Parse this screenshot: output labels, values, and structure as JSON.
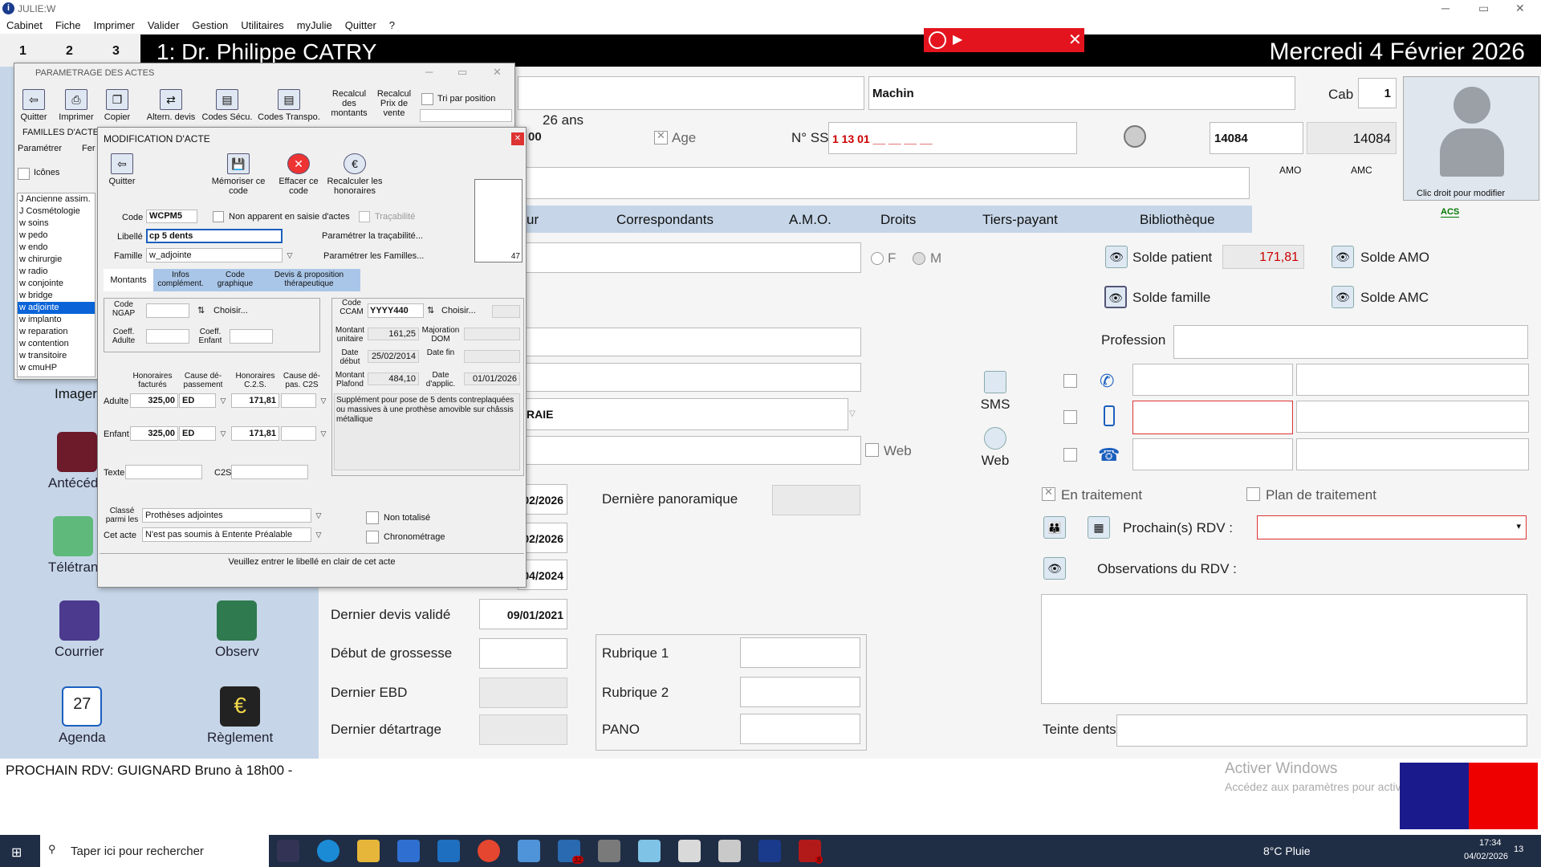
{
  "window": {
    "title": "JULIE:W",
    "controls": {
      "minimize": "─",
      "maximize": "▭",
      "close": "✕"
    }
  },
  "menu": [
    "Cabinet",
    "Fiche",
    "Imprimer",
    "Valider",
    "Gestion",
    "Utilitaires",
    "myJulie",
    "Quitter",
    "?"
  ],
  "header": {
    "tabs": [
      "1",
      "2",
      "3"
    ],
    "doctor": "1: Dr. Philippe CATRY",
    "date": "Mercredi 4 Février 2026",
    "rec_close": "✕"
  },
  "patient": {
    "firstname": "Machin",
    "age": "26 ans",
    "age_label": "Age",
    "ss_label": "N° SS",
    "ss_value": "1 13 01 __ __ __ __",
    "num1": "14084",
    "num2": "14084",
    "cab_label": "Cab",
    "cab_value": "1",
    "amo": "AMO",
    "amc": "AMC",
    "photo_hint": "Clic droit pour modifier",
    "acs": "ACS",
    "partial_00": "00"
  },
  "tabs": [
    "ur",
    "Correspondants",
    "A.M.O.",
    "Droits",
    "Tiers-payant",
    "Bibliothèque"
  ],
  "sex": {
    "f": "F",
    "m": "M"
  },
  "balances": {
    "patient_label": "Solde patient",
    "patient_value": "171,81",
    "amo_label": "Solde AMO",
    "famille_label": "Solde famille",
    "amc_label": "Solde AMC"
  },
  "contact": {
    "profession": "Profession",
    "sms": "SMS",
    "web": "Web",
    "web_check": "Web",
    "aie": "RAIE"
  },
  "dates": {
    "d1": "02/2026",
    "d2": "02/2026",
    "d3": "04/2024",
    "derniere_pano": "Dernière panoramique",
    "dernier_devis": "Dernier devis validé",
    "dernier_devis_val": "09/01/2021",
    "grossesse": "Début de grossesse",
    "ebd": "Dernier EBD",
    "detartrage": "Dernier détartrage",
    "rub1": "Rubrique 1",
    "rub2": "Rubrique 2",
    "pano": "PANO"
  },
  "rdv": {
    "en_traitement": "En traitement",
    "plan": "Plan de traitement",
    "prochain": "Prochain(s) RDV :",
    "obs": "Observations du RDV :",
    "teinte": "Teinte dents"
  },
  "sidebar": {
    "imagerie": "Imageri",
    "antecedents": "Antécéde",
    "teletrans": "Télétran",
    "courrier": "Courrier",
    "observ": "Observ",
    "agenda": "Agenda",
    "agenda_day": "27",
    "reglement": "Règlement"
  },
  "status": {
    "next_rdv": "PROCHAIN RDV: GUIGNARD Bruno à 18h00 -",
    "activate1": "Activer Windows",
    "activate2": "Accédez aux paramètres pour activer Windows."
  },
  "taskbar": {
    "search": "Taper ici pour rechercher",
    "weather": "8°C Pluie",
    "time": "17:34",
    "date": "04/02/2026",
    "badge": "13",
    "b32": "32",
    "b8": "8"
  },
  "param": {
    "title": "PARAMETRAGE DES ACTES",
    "tools": [
      "Quitter",
      "Imprimer",
      "Copier",
      "Altern. devis",
      "Codes Sécu.",
      "Codes Transpo."
    ],
    "recalc1": "Recalcul des montants",
    "recalc2": "Recalcul Prix de vente",
    "tri": "Tri par position",
    "familles": "FAMILLES D'ACTES",
    "parametrer": "Paramétrer",
    "fer": "Fer",
    "icones": "Icônes",
    "list": [
      "J  Ancienne assim.",
      "J  Cosmétologie",
      "w  soins",
      "w  pedo",
      "w  endo",
      "w  chirurgie",
      "w  radio",
      "w  conjointe",
      "w  bridge",
      "w  adjointe",
      "w  implanto",
      "w  reparation",
      "w  contention",
      "w  transitoire",
      "w  cmuHP"
    ]
  },
  "modif": {
    "title": "MODIFICATION D'ACTE",
    "close": "✕",
    "tools": [
      "Quitter",
      "Mémoriser ce code",
      "Effacer ce code",
      "Recalculer les honoraires"
    ],
    "tooth_num": "47",
    "code_label": "Code",
    "code": "WCPM5",
    "non_apparent": "Non apparent en saisie d'actes",
    "tracabilite": "Traçabilité",
    "libelle_label": "Libellé",
    "libelle": "cp 5 dents",
    "param_trac": "Paramétrer la traçabilité...",
    "famille_label": "Famille",
    "famille": "w_adjointe",
    "param_fam": "Paramétrer les Familles...",
    "tabs": [
      "Montants",
      "Infos complément.",
      "Code graphique",
      "Devis & proposition thérapeutique"
    ],
    "ngap_label": "Code NGAP",
    "choisir": "Choisir...",
    "coef_adulte": "Coeff. Adulte",
    "coef_enfant": "Coeff. Enfant",
    "ccam_label": "Code CCAM",
    "ccam": "YYYY440",
    "mont_unit_label": "Montant unitaire",
    "mont_unit": "161,25",
    "maj_dom": "Majoration DOM",
    "date_debut_label": "Date début",
    "date_debut": "25/02/2014",
    "date_fin_label": "Date fin",
    "plafond_label": "Montant Plafond",
    "plafond": "484,10",
    "date_applic_label": "Date d'applic.",
    "date_applic": "01/01/2026",
    "desc": "Supplément pour pose de 5 dents contreplaquées ou massives à une prothèse amovible sur châssis métallique",
    "h_fact": "Honoraires facturés",
    "cause_dep": "Cause dé-passement",
    "h_c2s": "Honoraires C.2.S.",
    "cause_dep_c2s": "Cause dé-pas. C2S",
    "adulte": "Adulte",
    "enfant": "Enfant",
    "adulte_h": "325,00",
    "adulte_cause": "ED",
    "adulte_c2s": "171,81",
    "enfant_h": "325,00",
    "enfant_cause": "ED",
    "enfant_c2s": "171,81",
    "texte": "Texte",
    "c2s": "C2S",
    "classe_label": "Classé parmi les",
    "classe": "Prothèses adjointes",
    "cet_acte_label": "Cet acte",
    "cet_acte": "N'est pas soumis à Entente Préalable",
    "non_totalise": "Non totalisé",
    "chrono": "Chronométrage",
    "hint": "Veuillez entrer le libellé en clair de cet acte"
  }
}
